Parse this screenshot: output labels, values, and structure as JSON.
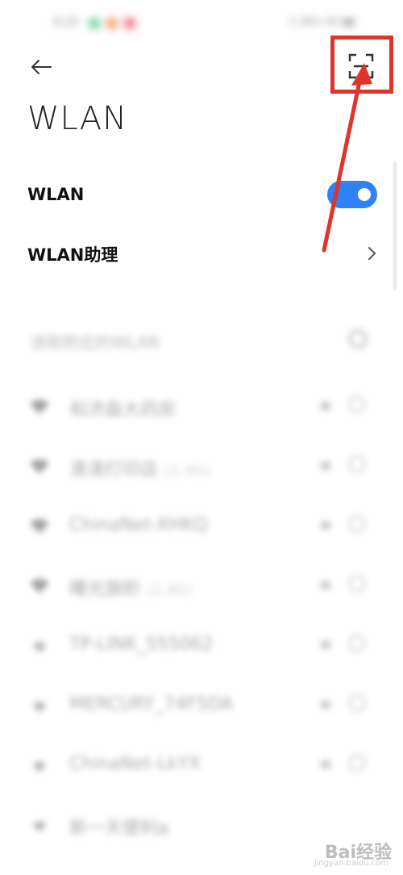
{
  "header": {
    "title": "WLAN",
    "back_icon": "arrow-left-icon",
    "scan_icon": "scan-icon"
  },
  "settings": {
    "wlan_label": "WLAN",
    "wlan_enabled": true,
    "assistant_label": "WLAN助理"
  },
  "networks_section": {
    "label": "选取附近的WLAN",
    "networks": [
      {
        "name": "和济森大药房",
        "suffix": ""
      },
      {
        "name": "清清打印店",
        "suffix": "(2.4G)"
      },
      {
        "name": "ChinaNet-XHKQ",
        "suffix": ""
      },
      {
        "name": "曙光旗帜",
        "suffix": "(2.4G)"
      },
      {
        "name": "TP-LINK_555062",
        "suffix": ""
      },
      {
        "name": "MERCURY_74F5DA",
        "suffix": ""
      },
      {
        "name": "ChinaNet-LkYX",
        "suffix": ""
      },
      {
        "name": "新一天便利a",
        "suffix": ""
      }
    ]
  },
  "watermark": {
    "text": "Bai经验",
    "sub": "jingyan.baidu.com"
  },
  "colors": {
    "accent": "#2e82f6",
    "highlight": "#e0332a"
  }
}
